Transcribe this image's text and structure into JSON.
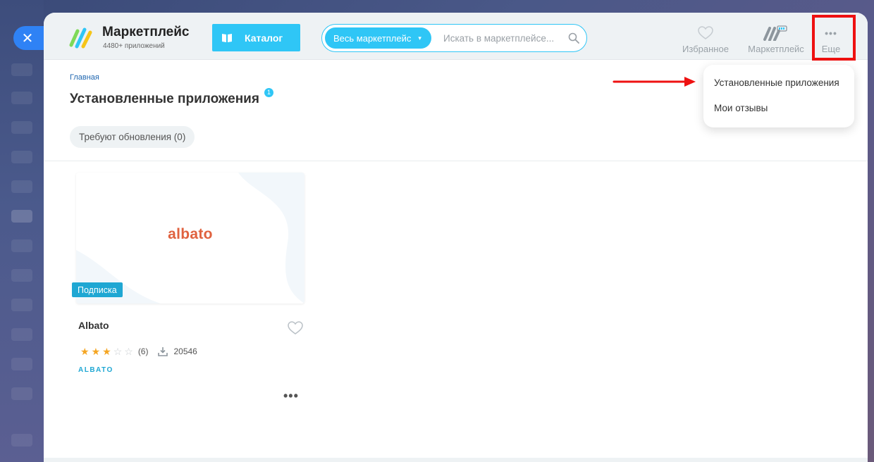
{
  "header": {
    "brand_title": "Маркетплейс",
    "brand_subtitle": "4480+ приложений",
    "catalog_label": "Каталог",
    "search_scope": "Весь маркетплейс",
    "search_placeholder": "Искать в маркетплейсе...",
    "nav": {
      "favorites": "Избранное",
      "marketplace": "Маркетплейс",
      "more": "Еще"
    }
  },
  "breadcrumb": "Главная",
  "page_title": "Установленные приложения",
  "title_badge": "1",
  "filter_chip": "Требуют обновления (0)",
  "app_card": {
    "logo_text": "albato",
    "badge": "Подписка",
    "name": "Albato",
    "rating": 3,
    "rating_max": 5,
    "rating_count": "(6)",
    "downloads": "20546",
    "vendor": "ALBATO",
    "more": "•••"
  },
  "dropdown": {
    "items": [
      "Установленные приложения",
      "Мои отзывы"
    ]
  },
  "colors": {
    "accent": "#2fc6f6",
    "badge": "#1fa7d3",
    "albato": "#e0623f",
    "highlight": "#ee1111",
    "star": "#f5a623"
  },
  "close_label": "✕"
}
